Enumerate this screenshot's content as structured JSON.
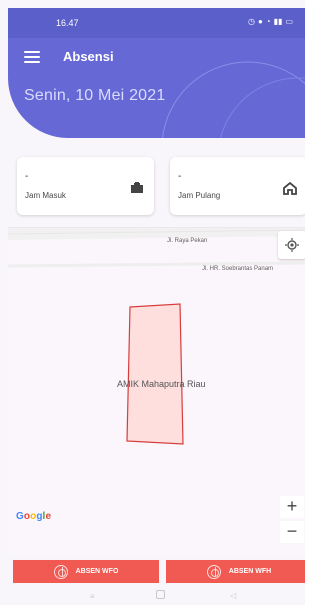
{
  "status": {
    "time": "16.47"
  },
  "app": {
    "title": "Absensi",
    "date": "Senin, 10 Mei 2021"
  },
  "cards": [
    {
      "value": "-",
      "label": "Jam Masuk",
      "icon": "briefcase-icon"
    },
    {
      "value": "-",
      "label": "Jam Pulang",
      "icon": "home-icon"
    }
  ],
  "map": {
    "roads": [
      "Jl. Raya Pekan",
      "Jl. HR. Soebrantas Panam"
    ],
    "place": "AMIK Mahaputra Riau",
    "attribution": [
      "G",
      "o",
      "o",
      "g",
      "l",
      "e"
    ],
    "zoom_in": "+",
    "zoom_out": "−"
  },
  "buttons": {
    "wfo": "ABSEN WFO",
    "wfh": "ABSEN WFH"
  },
  "nav": {
    "recent": "≡",
    "back": "◁"
  },
  "colors": {
    "header": "#6668d6",
    "status": "#5a5fc9",
    "accent": "#f05a52",
    "polygon_fill": "#ffdede",
    "polygon_stroke": "#d63d3d"
  }
}
